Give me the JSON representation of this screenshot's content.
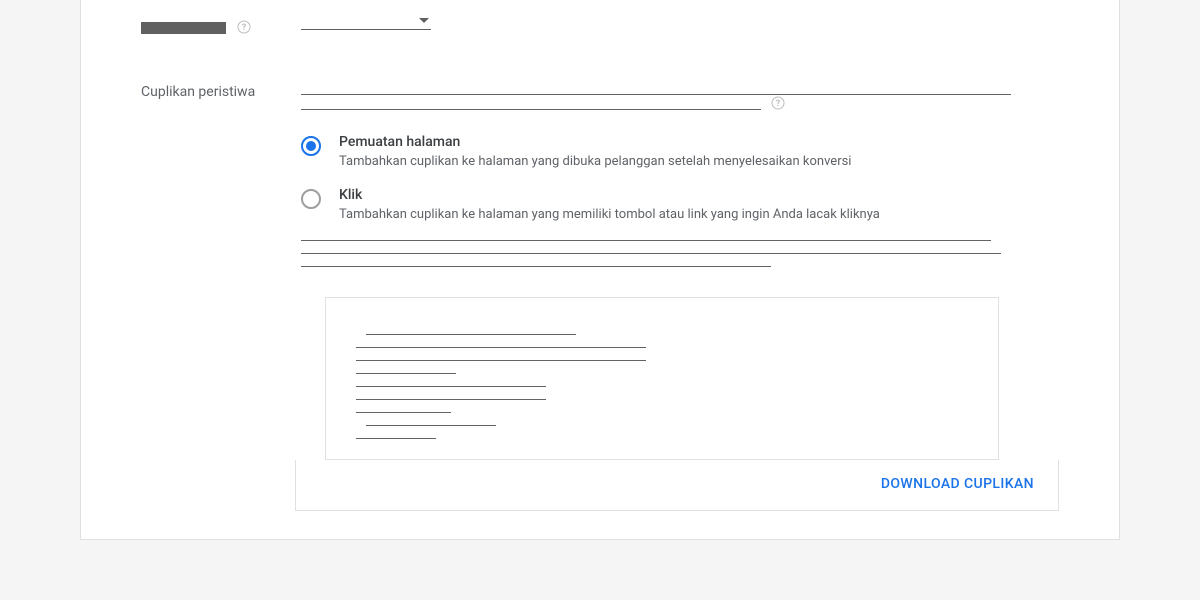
{
  "topRow": {
    "labelRedacted": true
  },
  "eventSnippet": {
    "label": "Cuplikan peristiwa",
    "options": [
      {
        "title": "Pemuatan halaman",
        "desc": "Tambahkan cuplikan ke halaman yang dibuka pelanggan setelah menyelesaikan konversi",
        "selected": true
      },
      {
        "title": "Klik",
        "desc": "Tambahkan cuplikan ke halaman yang memiliki tombol atau link yang ingin Anda lacak kliknya",
        "selected": false
      }
    ]
  },
  "actions": {
    "download": "DOWNLOAD CUPLIKAN"
  }
}
